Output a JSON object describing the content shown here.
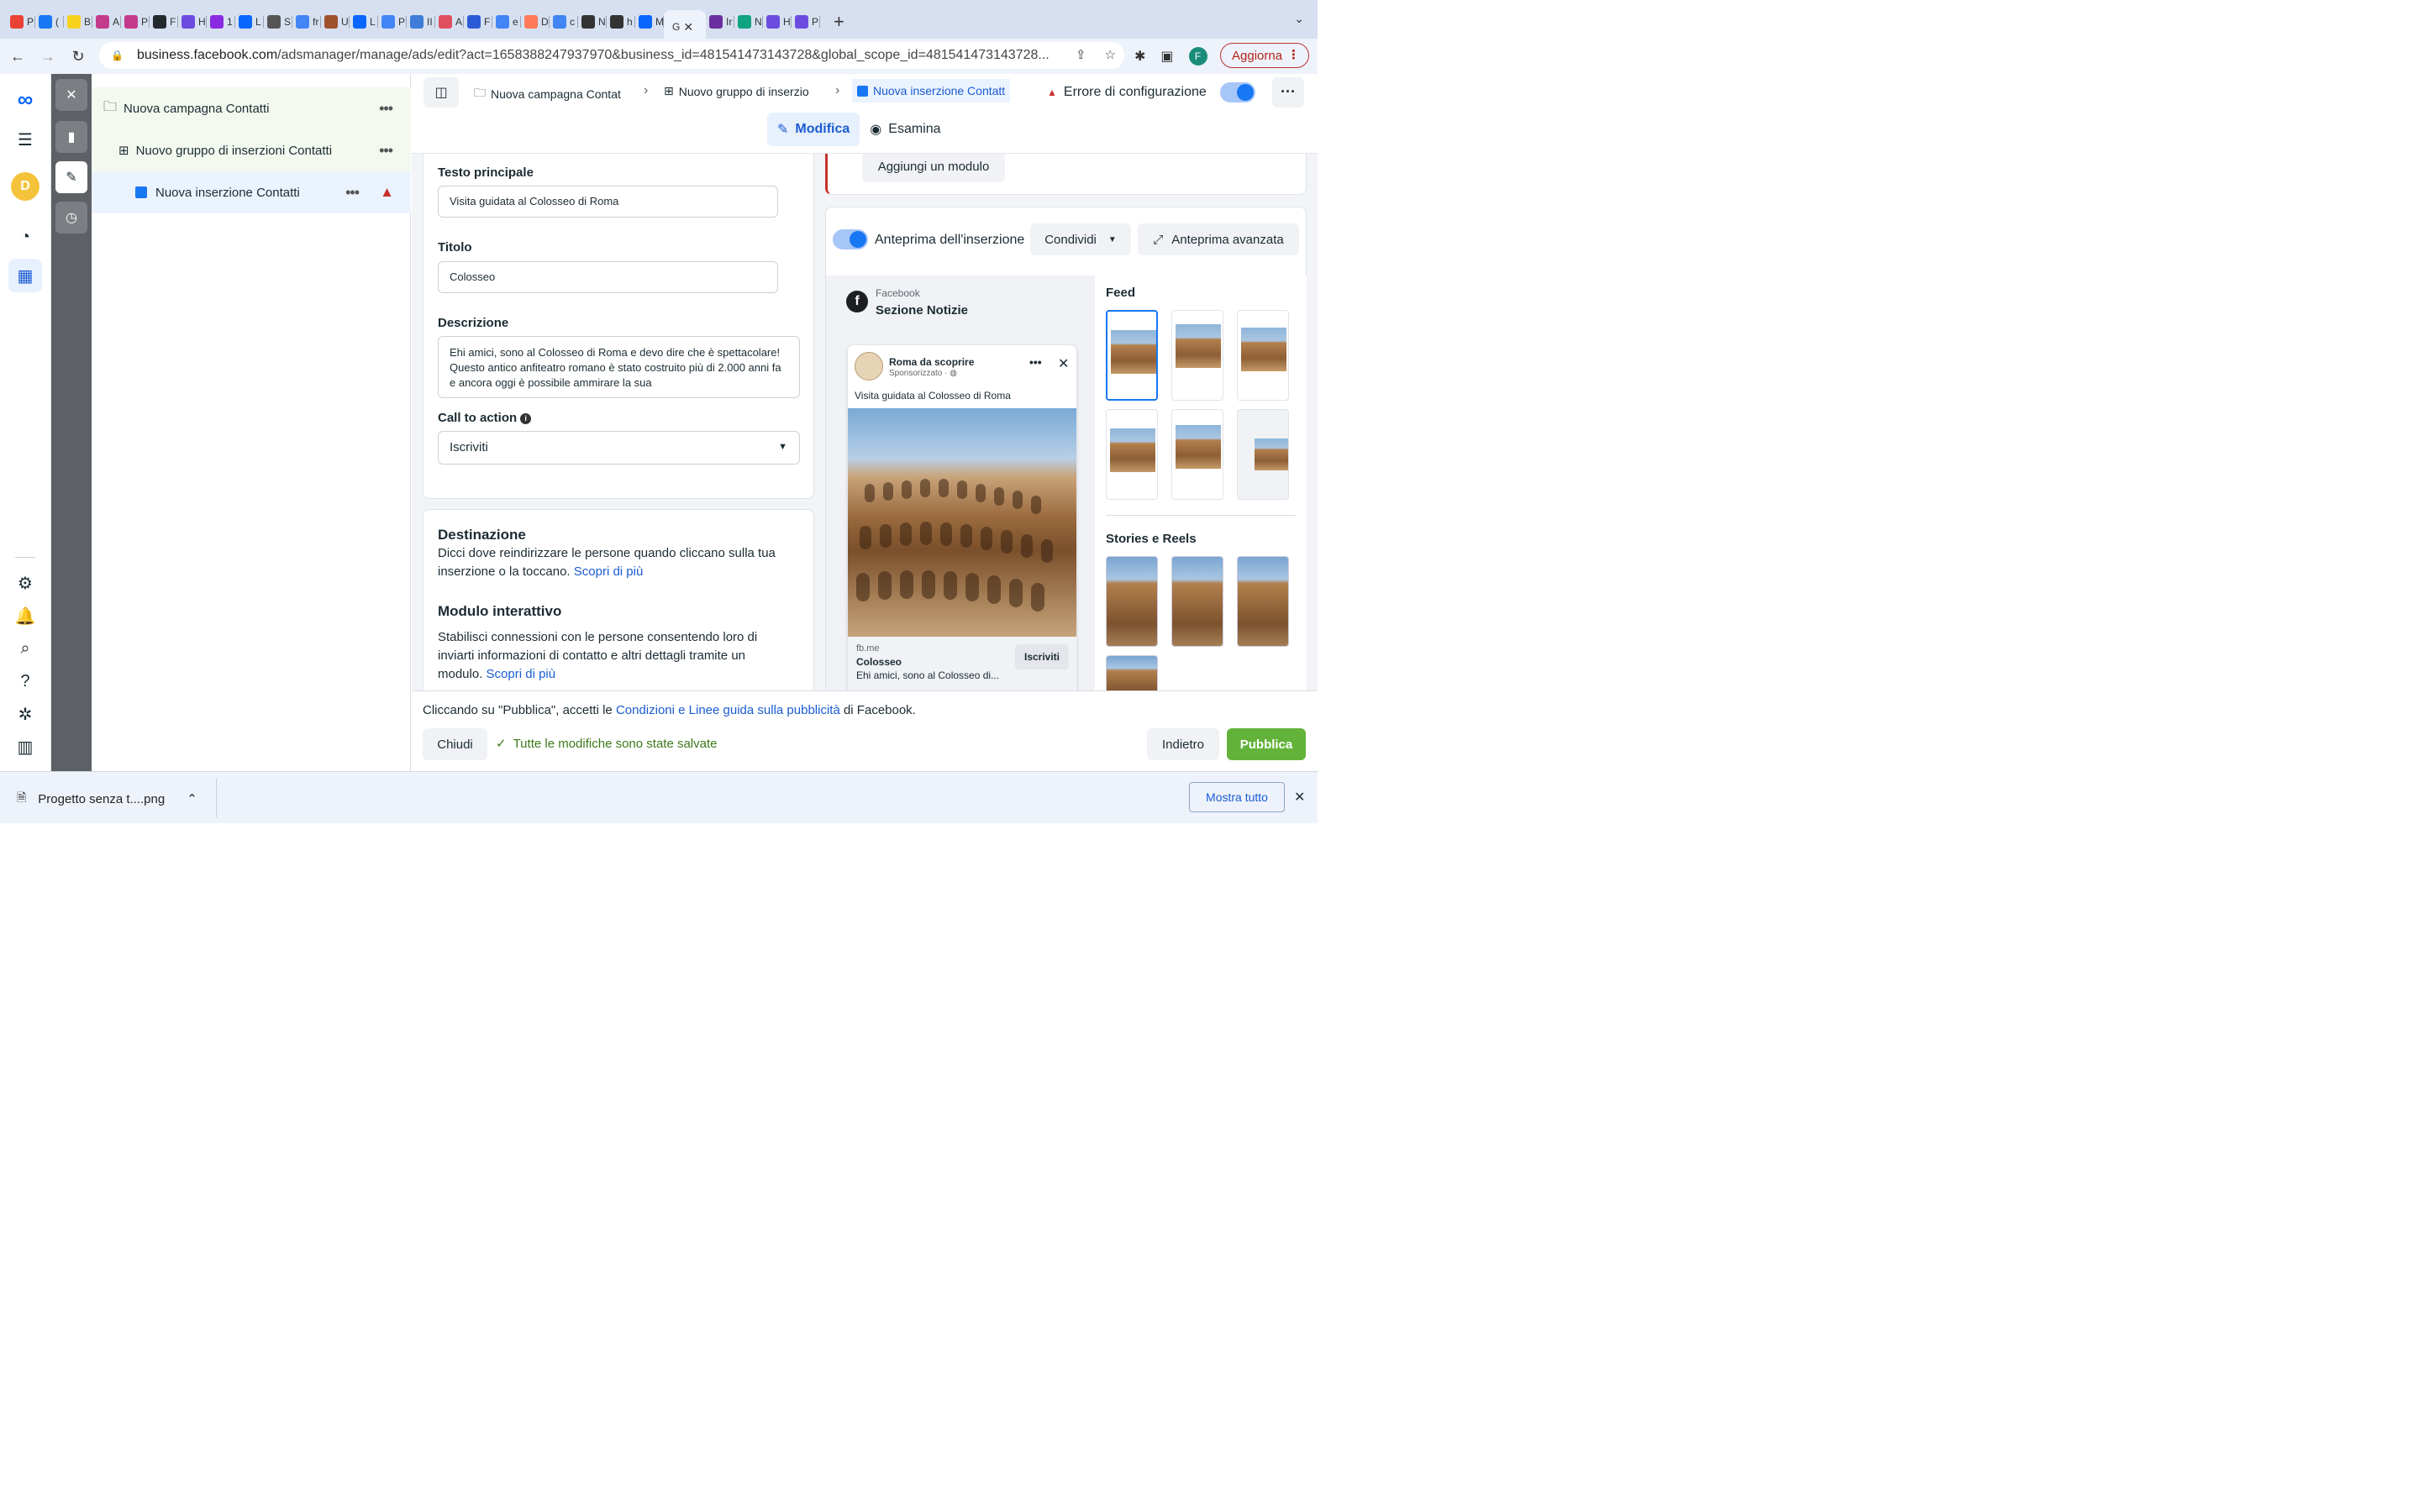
{
  "browser": {
    "tabs": [
      {
        "icon": "gmail-icon",
        "label": "P",
        "color": "#ea4335"
      },
      {
        "icon": "facebook-icon",
        "label": "(",
        "color": "#1877f2"
      },
      {
        "icon": "b-icon",
        "label": "B",
        "color": "#f7d21d"
      },
      {
        "icon": "a-icon",
        "label": "A",
        "color": "#c43b8c"
      },
      {
        "icon": "p-icon",
        "label": "P",
        "color": "#c43b8c"
      },
      {
        "icon": "github-icon",
        "label": "F",
        "color": "#24292e"
      },
      {
        "icon": "c-icon",
        "label": "H",
        "color": "#6c4ce0"
      },
      {
        "icon": "slash-icon",
        "label": "1",
        "color": "#8a2be2"
      },
      {
        "icon": "meta-icon",
        "label": "L",
        "color": "#0866ff"
      },
      {
        "icon": "link-icon",
        "label": "S",
        "color": "#555555"
      },
      {
        "icon": "google-icon",
        "label": "fr",
        "color": "#4285f4"
      },
      {
        "icon": "face-icon",
        "label": "U",
        "color": "#a0522d"
      },
      {
        "icon": "meta-icon",
        "label": "L",
        "color": "#0866ff"
      },
      {
        "icon": "google-icon",
        "label": "P",
        "color": "#4285f4"
      },
      {
        "icon": "spiral-icon",
        "label": "II",
        "color": "#3d7dd8"
      },
      {
        "icon": "grid-icon",
        "label": "A",
        "color": "#e04f5f"
      },
      {
        "icon": "m-icon",
        "label": "F",
        "color": "#2d5bd8"
      },
      {
        "icon": "google-icon",
        "label": "e",
        "color": "#4285f4"
      },
      {
        "icon": "hub-icon",
        "label": "D",
        "color": "#ff7a59"
      },
      {
        "icon": "google-icon",
        "label": "c",
        "color": "#4285f4"
      },
      {
        "icon": "openai-icon",
        "label": "N",
        "color": "#333333"
      },
      {
        "icon": "globe-icon",
        "label": "h",
        "color": "#333333"
      },
      {
        "icon": "meta-icon",
        "label": "M",
        "color": "#0866ff"
      }
    ],
    "active_tab": {
      "label": "G",
      "close": "✕"
    },
    "tabs_after": [
      {
        "icon": "threads-icon",
        "label": "Ir",
        "color": "#6b2fa0"
      },
      {
        "icon": "openai-icon",
        "label": "N",
        "color": "#10a37f"
      },
      {
        "icon": "c-icon",
        "label": "H",
        "color": "#6c4ce0"
      },
      {
        "icon": "c-icon",
        "label": "P",
        "color": "#6c4ce0"
      }
    ],
    "new_tab": "+",
    "url_host": "business.facebook.com",
    "url_path": "/adsmanager/manage/ads/edit?act=1658388247937970&business_id=481541473143728&global_scope_id=481541473143728...",
    "profile_initial": "F",
    "update_label": "Aggiorna"
  },
  "rail": {
    "avatar_initial": "D"
  },
  "tree": {
    "campaign": "Nuova campagna Contatti",
    "adset": "Nuovo gruppo di inserzioni Contatti",
    "ad": "Nuova inserzione Contatti"
  },
  "breadcrumbs": {
    "campaign": "Nuova campagna Contat",
    "adset": "Nuovo gruppo di inserzio",
    "ad": "Nuova inserzione Contatt",
    "error": "Errore di configurazione"
  },
  "modes": {
    "edit": "Modifica",
    "review": "Esamina"
  },
  "form": {
    "primary_text_label": "Testo principale",
    "primary_text": "Visita guidata al Colosseo di Roma",
    "headline_label": "Titolo",
    "headline": "Colosseo",
    "description_label": "Descrizione",
    "description": "Ehi amici, sono al Colosseo di Roma e devo dire che è spettacolare! Questo antico anfiteatro romano è stato costruito più di 2.000 anni fa e ancora oggi è possibile ammirare la sua",
    "cta_label": "Call to action",
    "cta_value": "Iscriviti",
    "add_module": "Aggiungi un modulo"
  },
  "destination": {
    "title": "Destinazione",
    "text": "Dicci dove reindirizzare le persone quando cliccano sulla tua inserzione o la toccano.",
    "link": "Scopri di più",
    "form_title": "Modulo interattivo",
    "form_text": "Stabilisci connessioni con le persone consentendo loro di inviarti informazioni di contatto e altri dettagli tramite un modulo.",
    "form_link": "Scopri di più"
  },
  "preview": {
    "toggle_label": "Anteprima dell'inserzione",
    "share": "Condividi",
    "advanced": "Anteprima avanzata",
    "platform": "Facebook",
    "placement": "Sezione Notizie",
    "page_name": "Roma da scoprire",
    "sponsored": "Sponsorizzato",
    "post_text": "Visita guidata al Colosseo di Roma",
    "domain": "fb.me",
    "headline": "Colosseo",
    "desc_snippet": "Ehi amici, sono al Colosseo di...",
    "cta": "Iscriviti",
    "feed_label": "Feed",
    "stories_label": "Stories e Reels"
  },
  "footer": {
    "terms_prefix": "Cliccando su \"Pubblica\", accetti le",
    "terms_link": "Condizioni e Linee guida sulla pubblicità",
    "terms_suffix": "di Facebook.",
    "close": "Chiudi",
    "saved": "Tutte le modifiche sono state salvate",
    "back": "Indietro",
    "publish": "Pubblica"
  },
  "downloads": {
    "file": "Progetto senza t....png",
    "show_all": "Mostra tutto"
  }
}
